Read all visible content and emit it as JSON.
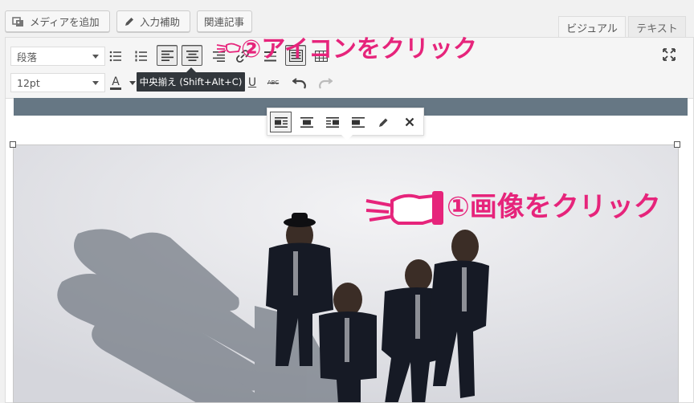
{
  "media_buttons": {
    "add_media": "メディアを追加",
    "input_assist": "入力補助",
    "related_posts": "関連記事"
  },
  "tabs": {
    "visual": "ビジュアル",
    "text": "テキスト"
  },
  "toolbar": {
    "format_select": "段落",
    "font_size_select": "12pt",
    "font_color_label": "A",
    "underline_label": "U",
    "strike_label": "ABC"
  },
  "tooltip": {
    "text": "中央揃え (Shift+Alt+C)"
  },
  "annotations": {
    "step1": "①画像をクリック",
    "step2": "②アイコンをクリック"
  },
  "colors": {
    "accent_pink": "#e6247b",
    "banner": "#667784",
    "tooltip_bg": "#32373c"
  }
}
